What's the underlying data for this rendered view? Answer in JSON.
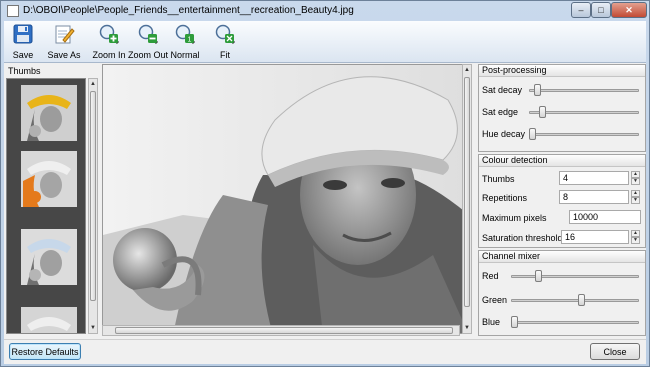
{
  "window": {
    "title": "D:\\OBOI\\People\\People_Friends__entertainment__recreation_Beauty4.jpg",
    "minimize": "–",
    "maximize": "□",
    "close": "✕"
  },
  "toolbar": {
    "items": [
      {
        "label": "Save",
        "icon": "floppy-disk-icon"
      },
      {
        "label": "Save As",
        "icon": "notepad-pencil-icon"
      },
      {
        "label": "Zoom In",
        "icon": "zoom-in-icon"
      },
      {
        "label": "Zoom Out",
        "icon": "zoom-out-icon"
      },
      {
        "label": "Normal",
        "icon": "zoom-normal-icon"
      },
      {
        "label": "Fit",
        "icon": "zoom-fit-icon"
      }
    ]
  },
  "thumbs": {
    "title": "Thumbs",
    "count_visible": 4
  },
  "post_processing": {
    "title": "Post-processing",
    "sliders": [
      {
        "label": "Sat decay",
        "value": 0.05
      },
      {
        "label": "Sat edge",
        "value": 0.1
      },
      {
        "label": "Hue decay",
        "value": 0.0
      }
    ]
  },
  "colour_detection": {
    "title": "Colour detection",
    "fields": [
      {
        "label": "Thumbs",
        "value": "4",
        "spin": true
      },
      {
        "label": "Repetitions",
        "value": "8",
        "spin": true
      },
      {
        "label": "Maximum pixels",
        "value": "10000",
        "spin": false
      },
      {
        "label": "Saturation threshold",
        "value": "16",
        "spin": true
      }
    ]
  },
  "channel_mixer": {
    "title": "Channel mixer",
    "sliders": [
      {
        "label": "Red",
        "value": 0.2
      },
      {
        "label": "Green",
        "value": 0.55
      },
      {
        "label": "Blue",
        "value": 0.0
      }
    ]
  },
  "footer": {
    "restore_label": "Restore Defaults",
    "close_label": "Close"
  },
  "colors": {
    "accent": "#3c7fb1",
    "thumb_strip_bg": "#474747",
    "highlight_yellow": "#e8b419",
    "highlight_orange": "#e47a1c"
  }
}
